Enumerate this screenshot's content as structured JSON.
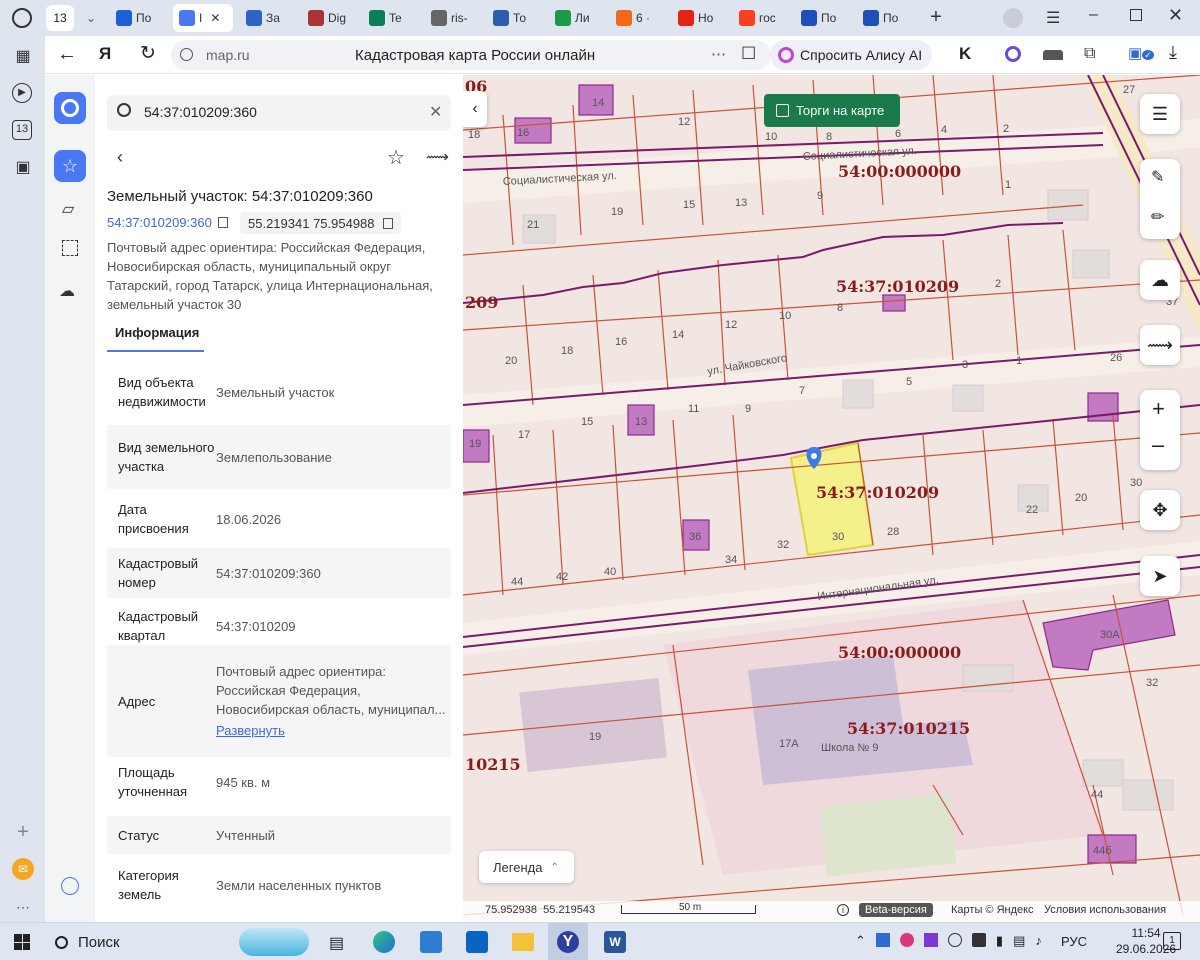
{
  "browser": {
    "tab_count_badge": "13",
    "tabs": [
      {
        "label": "По",
        "favicon": "mail-icon",
        "color": "#1e5fd6"
      },
      {
        "label": "I",
        "favicon": "alice-icon",
        "color": "#4a78f5",
        "active": true
      },
      {
        "label": "За",
        "favicon": "doc-icon",
        "color": "#2e64c5"
      },
      {
        "label": "Dig",
        "favicon": "dig-icon",
        "color": "#a33"
      },
      {
        "label": "Te",
        "favicon": "tk-icon",
        "color": "#0a7f5a"
      },
      {
        "label": "ris-",
        "favicon": "page-icon",
        "color": "#666"
      },
      {
        "label": "То",
        "favicon": "emblem-icon",
        "color": "#2a5db0"
      },
      {
        "label": "Ли",
        "favicon": "map-icon",
        "color": "#1a9b47"
      },
      {
        "label": "6 ·",
        "favicon": "mail-envelope-icon",
        "color": "#f06a1a"
      },
      {
        "label": "Но",
        "favicon": "youtube-icon",
        "color": "#e62117"
      },
      {
        "label": "гос",
        "favicon": "yandex-icon",
        "color": "#fc3f1d"
      },
      {
        "label": "По",
        "favicon": "flag-icon",
        "color": "#1c4fb7"
      },
      {
        "label": "По",
        "favicon": "flag-icon",
        "color": "#1c4fb7"
      }
    ],
    "url_domain": "map.ru",
    "page_title": "Кадастровая карта России онлайн",
    "alice_button": "Спросить Алису AI",
    "extensions_badge": "✓"
  },
  "left_rail": {
    "counter": "13"
  },
  "panel": {
    "search_value": "54:37:010209:360",
    "title": "Земельный участок: 54:37:010209:360",
    "cad_link": "54:37:010209:360",
    "coords": "55.219341 75.954988",
    "address_line": "Почтовый адрес ориентира: Российская Федерация, Новосибирская область, муниципальный округ Татарский, город Татарск, улица Интернациональная, земельный участок 30",
    "tab_info": "Информация",
    "rows": [
      {
        "k": "Вид объекта недвижимости",
        "v": "Земельный участок"
      },
      {
        "k": "Вид земельного участка",
        "v": "Землепользование"
      },
      {
        "k": "Дата присвоения",
        "v": "18.06.2026"
      },
      {
        "k": "Кадастровый номер",
        "v": "54:37:010209:360"
      },
      {
        "k": "Кадастровый квартал",
        "v": "54:37:010209"
      },
      {
        "k": "Адрес",
        "v": "Почтовый адрес ориентира: Российская Федерация, Новосибирская область, муниципал...",
        "link": "Развернуть"
      },
      {
        "k": "Площадь уточненная",
        "v": "945 кв. м"
      },
      {
        "k": "Статус",
        "v": "Учтенный"
      },
      {
        "k": "Категория земель",
        "v": "Земли населенных пунктов"
      }
    ]
  },
  "map": {
    "auction_toggle": "Торги на карте",
    "legend": "Легенда",
    "cursor_coords": "75.952938  55.219543",
    "scale": "50 m",
    "beta": "Beta-версия",
    "attribution": "Карты © Яндекс",
    "terms": "Условия использования",
    "streets": [
      "Социалистическая ул.",
      "ул. Чайковского",
      "Интернациональная ул."
    ],
    "quarters": [
      "54:00:000000",
      "54:37:010209",
      "54:37:010209",
      "54:00:000000",
      "54:37:010215",
      "10215",
      "209",
      "06"
    ],
    "school": "Школа № 9",
    "house_numbers": [
      "14",
      "16",
      "12",
      "10",
      "8",
      "6",
      "4",
      "2",
      "18",
      "27",
      "1",
      "21",
      "19",
      "15",
      "13",
      "9",
      "8",
      "2",
      "37",
      "20",
      "18",
      "16",
      "14",
      "12",
      "10",
      "5",
      "3",
      "1",
      "26",
      "19",
      "17",
      "15",
      "13",
      "11",
      "9",
      "7",
      "32",
      "30",
      "28",
      "22",
      "20",
      "30",
      "36",
      "34",
      "44",
      "42",
      "40",
      "30А",
      "32",
      "19",
      "17А",
      "44",
      "44б"
    ]
  },
  "taskbar": {
    "search": "Поиск",
    "lang": "РУС",
    "time": "11:54",
    "date": "29.06.2026",
    "notif": "1"
  },
  "colors": {
    "accent": "#4a78f5",
    "cadastre_line": "#c8523a",
    "quarter_line": "#7a1a6b",
    "selected_parcel": "#f4f08c",
    "auction_green": "#1b7a4a"
  }
}
